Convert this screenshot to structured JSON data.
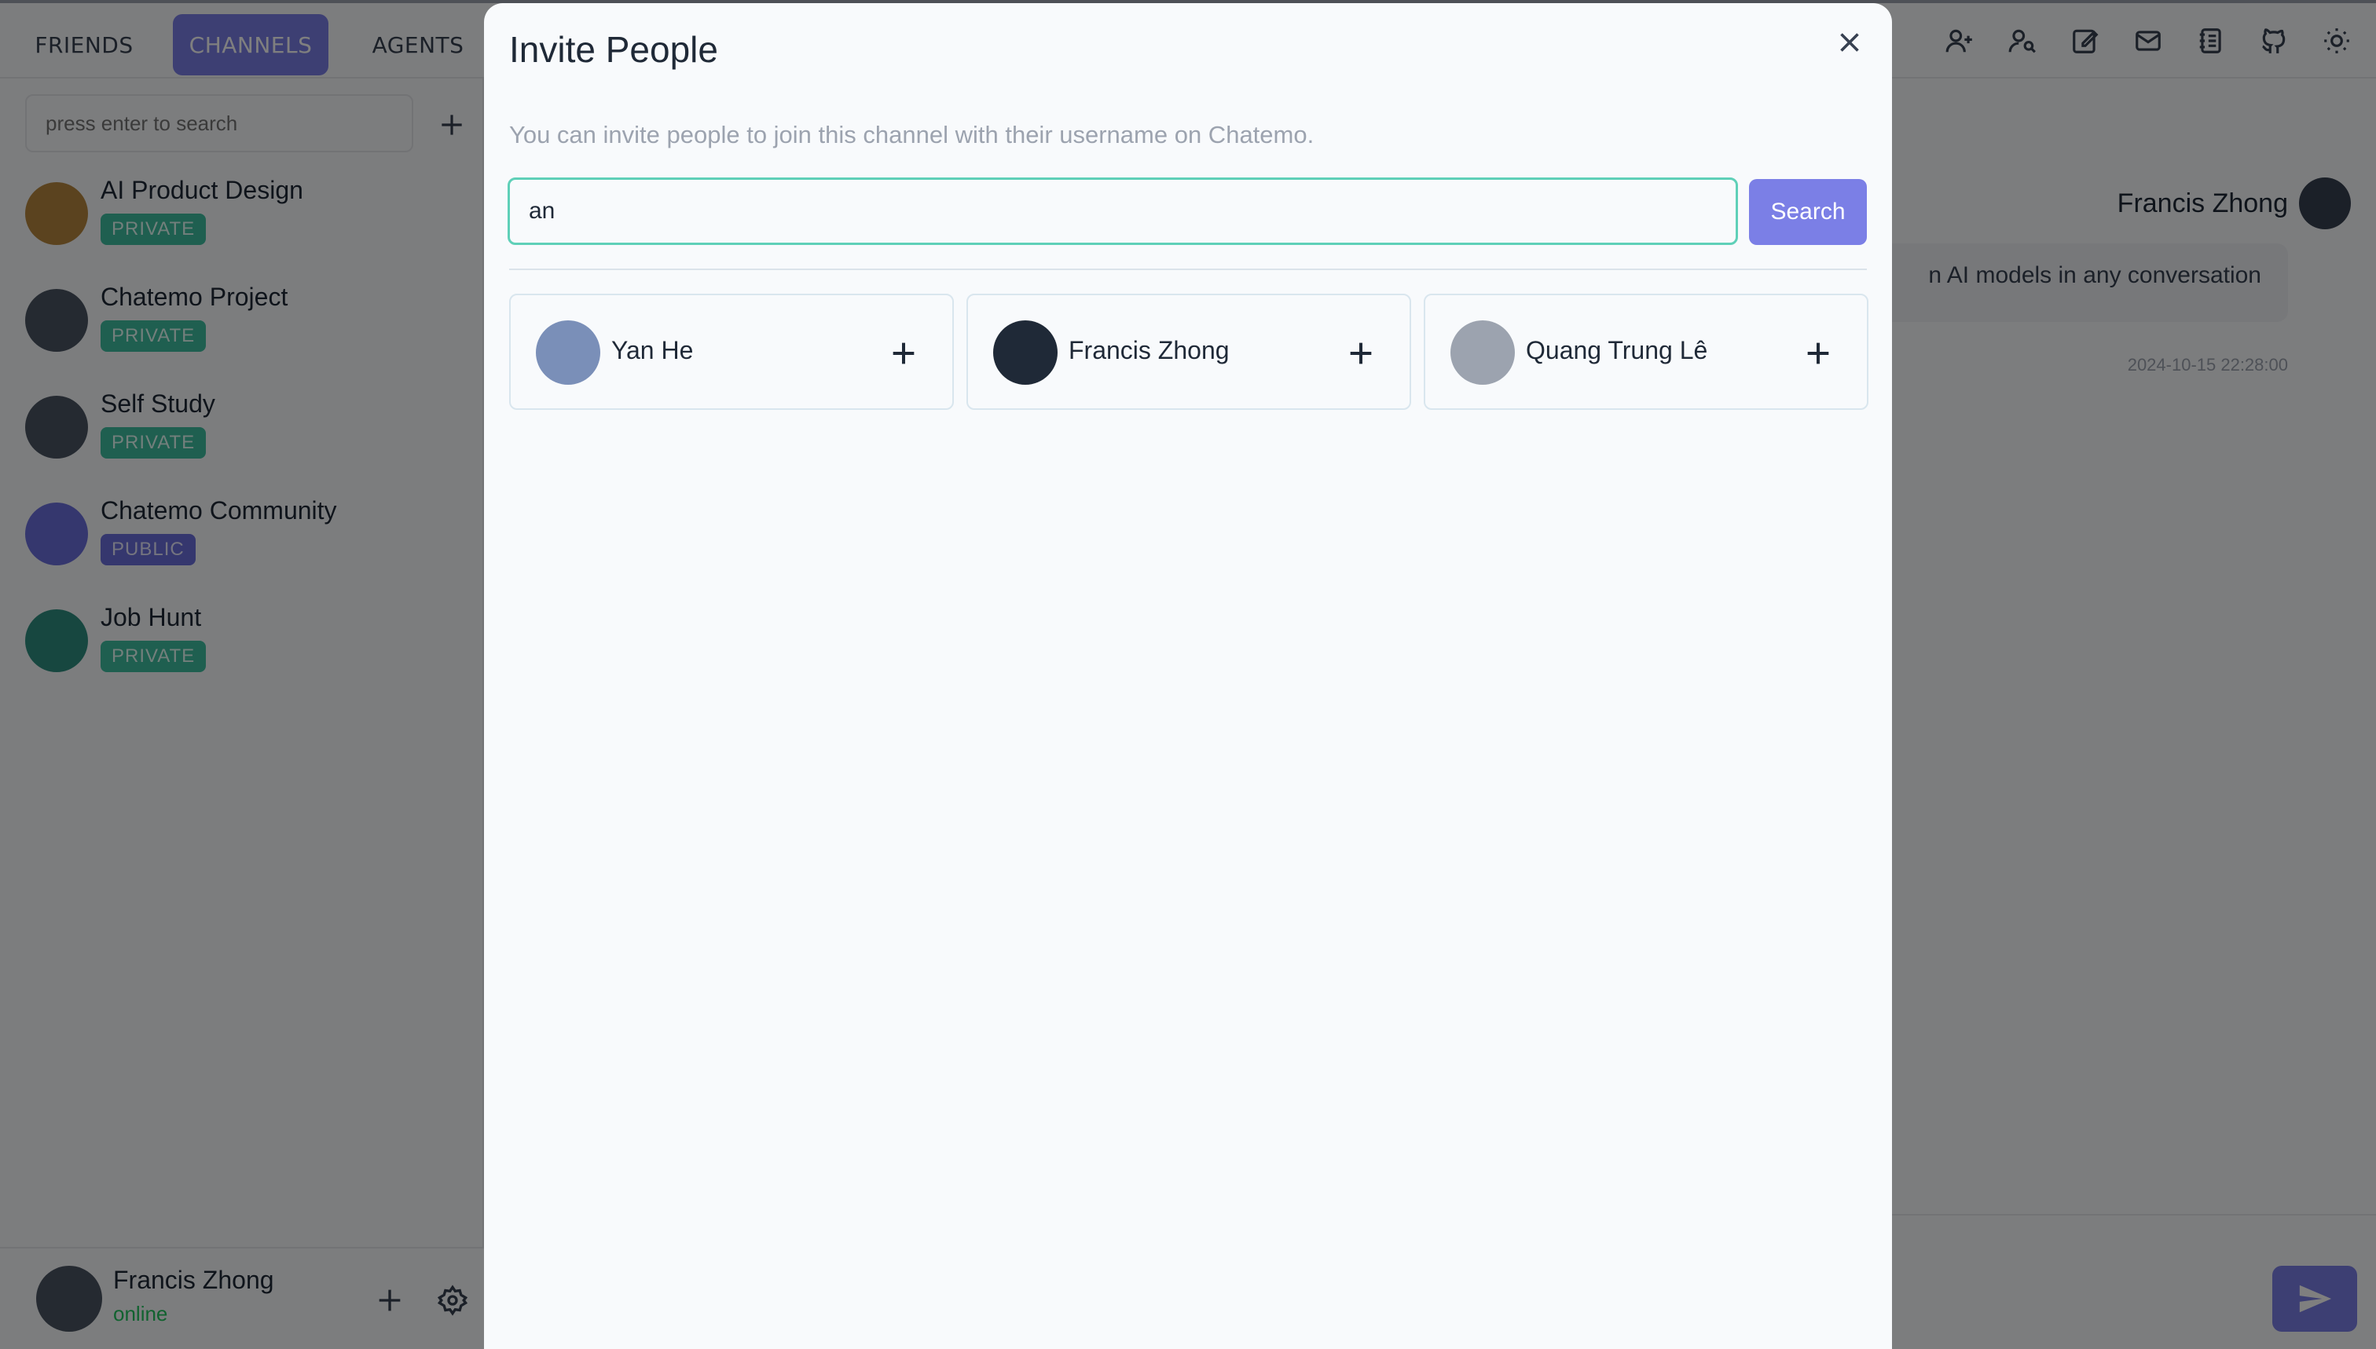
{
  "nav": {
    "tabs": [
      {
        "label": "FRIENDS"
      },
      {
        "label": "CHANNELS"
      },
      {
        "label": "AGENTS"
      }
    ],
    "icons": [
      "add-friend-icon",
      "search-user-icon",
      "edit-icon",
      "mail-icon",
      "notebook-icon",
      "github-icon",
      "theme-toggle-icon"
    ]
  },
  "sidebar": {
    "search_placeholder": "press enter to search",
    "channels": [
      {
        "name": "AI Product Design",
        "badge": "PRIVATE"
      },
      {
        "name": "Chatemo Project",
        "badge": "PRIVATE"
      },
      {
        "name": "Self Study",
        "badge": "PRIVATE"
      },
      {
        "name": "Chatemo Community",
        "badge": "PUBLIC"
      },
      {
        "name": "Job Hunt",
        "badge": "PRIVATE"
      }
    ],
    "user": {
      "name": "Francis Zhong",
      "status": "online"
    }
  },
  "chat": {
    "sender": "Francis Zhong",
    "message": "n AI models in any conversation",
    "timestamp": "2024-10-15 22:28:00"
  },
  "modal": {
    "title": "Invite People",
    "description": "You can invite people to join this channel with their username on Chatemo.",
    "search_value": "an",
    "search_label": "Search",
    "results": [
      {
        "name": "Yan He"
      },
      {
        "name": "Francis Zhong"
      },
      {
        "name": "Quang Trung Lê"
      }
    ]
  },
  "colors": {
    "accent": "#7b7fe6",
    "focus_border": "#5fd0b8",
    "private_badge": "#3ebea0",
    "public_badge": "#6b6fdc",
    "online": "#22c55e"
  }
}
